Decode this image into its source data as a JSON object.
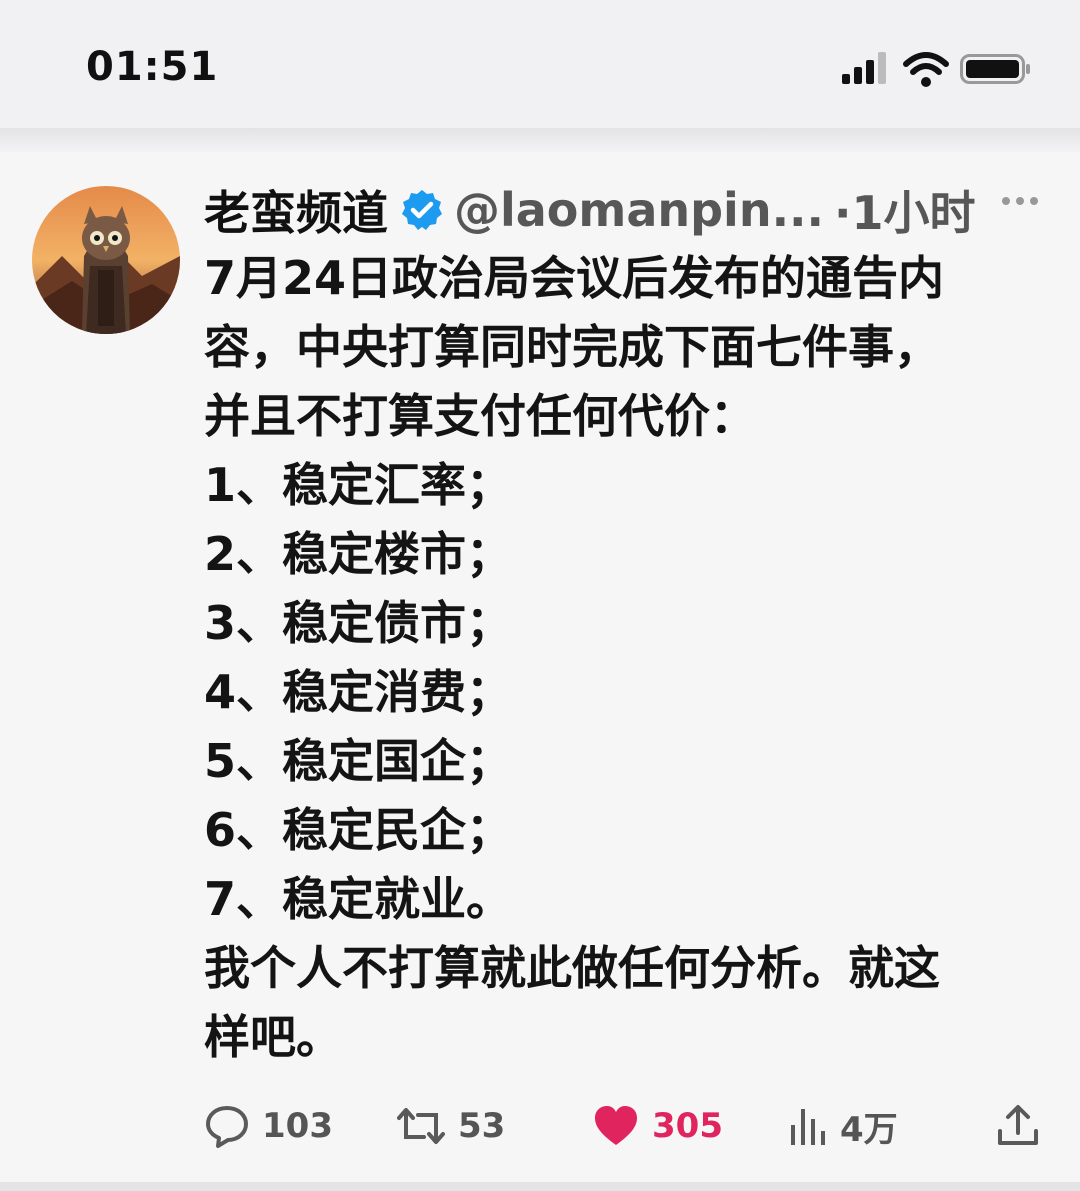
{
  "status_bar": {
    "time": "01:51"
  },
  "tweet": {
    "author_name": "老蛮频道",
    "handle": "@laomanpin...",
    "time": "·1小时",
    "verified": true,
    "lines": [
      "7月24日政治局会议后发布的通告内",
      "容，中央打算同时完成下面七件事，",
      "并且不打算支付任何代价：",
      "1、稳定汇率；",
      "2、稳定楼市；",
      "3、稳定债市；",
      "4、稳定消费；",
      "5、稳定国企；",
      "6、稳定民企；",
      "7、稳定就业。",
      "我个人不打算就此做任何分析。就这",
      "样吧。"
    ],
    "actions": {
      "replies": "103",
      "retweets": "53",
      "likes": "305",
      "views": "4万"
    }
  },
  "colors": {
    "like": "#e0245e",
    "verified": "#1d9bf0",
    "muted": "#575757"
  },
  "icons": [
    "signal-icon",
    "wifi-icon",
    "battery-icon",
    "verified-badge-icon",
    "more-icon",
    "reply-icon",
    "retweet-icon",
    "heart-icon",
    "views-icon",
    "share-icon"
  ]
}
